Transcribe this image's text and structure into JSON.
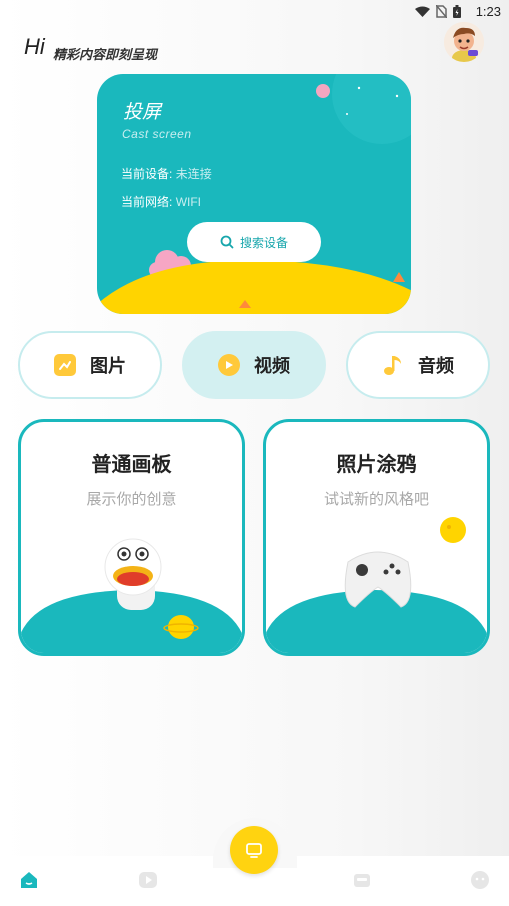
{
  "status_bar": {
    "time": "1:23"
  },
  "header": {
    "greeting": "Hi",
    "tagline": "精彩内容即刻呈现"
  },
  "cast": {
    "title": "投屏",
    "subtitle": "Cast screen",
    "device_label": "当前设备:",
    "device_value": "未连接",
    "network_label": "当前网络:",
    "network_value": "WIFI",
    "search_button": "搜索设备"
  },
  "categories": [
    {
      "label": "图片",
      "icon": "image-icon"
    },
    {
      "label": "视频",
      "icon": "play-icon"
    },
    {
      "label": "音频",
      "icon": "music-note-icon"
    }
  ],
  "boards": [
    {
      "title": "普通画板",
      "subtitle": "展示你的创意"
    },
    {
      "title": "照片涂鸦",
      "subtitle": "试试新的风格吧"
    }
  ],
  "bottom_nav": {
    "items": [
      {
        "icon": "home-icon",
        "active": true
      },
      {
        "icon": "play-tab-icon",
        "active": false
      },
      {
        "icon": "cast-center-icon",
        "active": false
      },
      {
        "icon": "toolbox-icon",
        "active": false
      },
      {
        "icon": "profile-face-icon",
        "active": false
      }
    ]
  },
  "colors": {
    "teal": "#1ab8bd",
    "yellow": "#ffd310",
    "pill_border": "#c6ecee"
  }
}
